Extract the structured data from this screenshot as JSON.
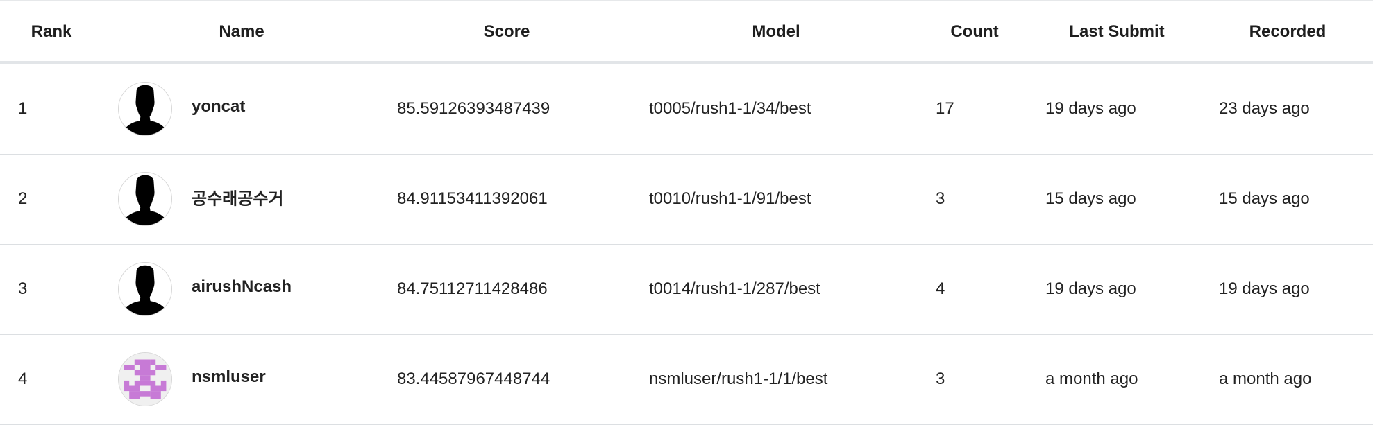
{
  "headers": {
    "rank": "Rank",
    "name": "Name",
    "score": "Score",
    "model": "Model",
    "count": "Count",
    "last_submit": "Last Submit",
    "recorded": "Recorded"
  },
  "rows": [
    {
      "rank": "1",
      "avatar": "default-silhouette-avatar-icon",
      "name": "yoncat",
      "score": "85.59126393487439",
      "model": "t0005/rush1-1/34/best",
      "count": "17",
      "last_submit": "19 days ago",
      "recorded": "23 days ago"
    },
    {
      "rank": "2",
      "avatar": "default-silhouette-avatar-icon",
      "name": "공수래공수거",
      "score": "84.91153411392061",
      "model": "t0010/rush1-1/91/best",
      "count": "3",
      "last_submit": "15 days ago",
      "recorded": "15 days ago"
    },
    {
      "rank": "3",
      "avatar": "default-silhouette-avatar-icon",
      "name": "airushNcash",
      "score": "84.75112711428486",
      "model": "t0014/rush1-1/287/best",
      "count": "4",
      "last_submit": "19 days ago",
      "recorded": "19 days ago"
    },
    {
      "rank": "4",
      "avatar": "identicon-avatar-icon",
      "name": "nsmluser",
      "score": "83.44587967448744",
      "model": "nsmluser/rush1-1/1/best",
      "count": "3",
      "last_submit": "a month ago",
      "recorded": "a month ago"
    }
  ],
  "colors": {
    "identicon": "#c77ad6",
    "text": "#222222",
    "divider": "#dcdfe2"
  }
}
